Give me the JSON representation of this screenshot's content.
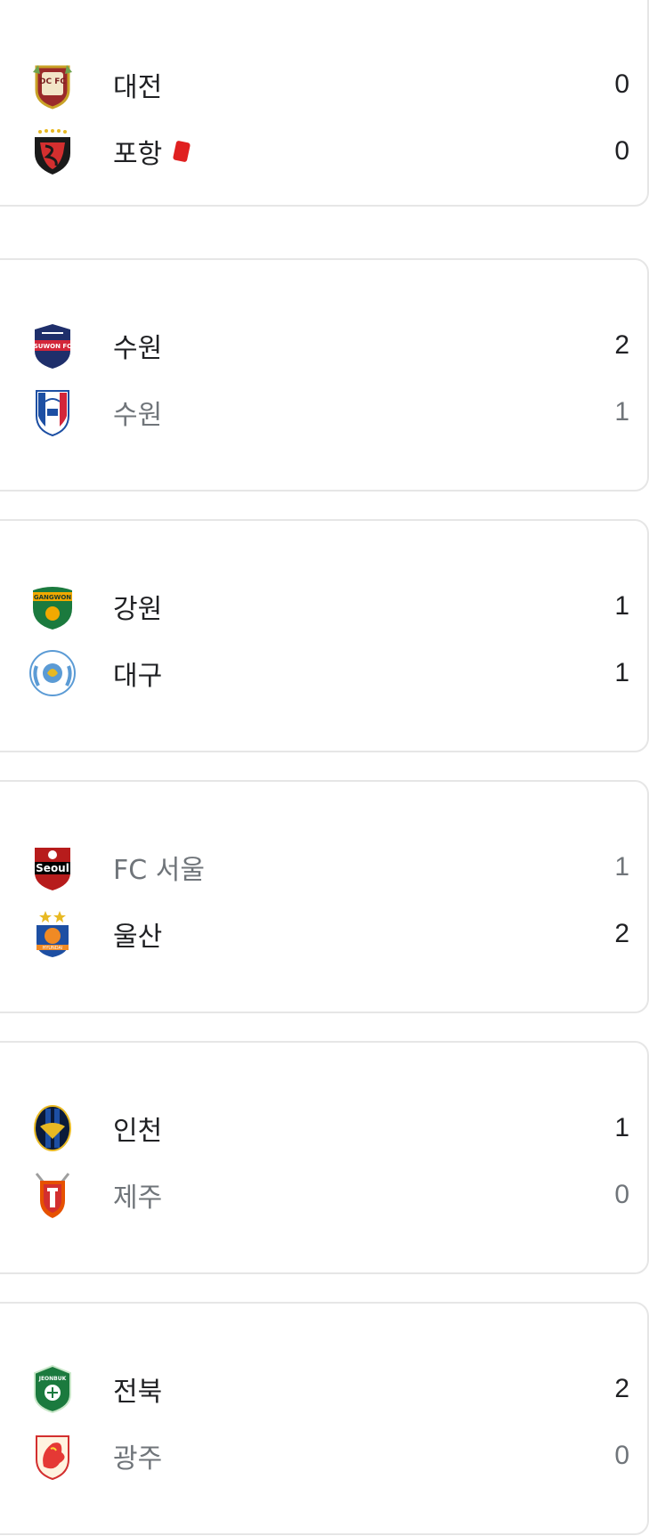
{
  "matches": [
    {
      "home": {
        "name": "대전",
        "score": "0",
        "crest": "daejeon-crest-icon"
      },
      "away": {
        "name": "포항",
        "score": "0",
        "crest": "pohang-crest-icon",
        "red_card": true
      }
    },
    {
      "home": {
        "name": "수원",
        "score": "2",
        "crest": "suwon-fc-crest-icon"
      },
      "away": {
        "name": "수원",
        "score": "1",
        "crest": "suwon-samsung-crest-icon"
      }
    },
    {
      "home": {
        "name": "강원",
        "score": "1",
        "crest": "gangwon-crest-icon"
      },
      "away": {
        "name": "대구",
        "score": "1",
        "crest": "daegu-crest-icon"
      }
    },
    {
      "home": {
        "name": "FC 서울",
        "score": "1",
        "crest": "fc-seoul-crest-icon"
      },
      "away": {
        "name": "울산",
        "score": "2",
        "crest": "ulsan-crest-icon"
      }
    },
    {
      "home": {
        "name": "인천",
        "score": "1",
        "crest": "incheon-crest-icon"
      },
      "away": {
        "name": "제주",
        "score": "0",
        "crest": "jeju-crest-icon"
      }
    },
    {
      "home": {
        "name": "전북",
        "score": "2",
        "crest": "jeonbuk-crest-icon"
      },
      "away": {
        "name": "광주",
        "score": "0",
        "crest": "gwangju-crest-icon"
      }
    }
  ],
  "crest_labels": {
    "daejeon": "DC FC",
    "suwon_fc": "SUWON FC",
    "gangwon": "GANGWON",
    "seoul": "Seoul",
    "ulsan": "HYUNDAI",
    "jeonbuk": "JEONBUK"
  },
  "colors": {
    "text_primary": "#202124",
    "text_secondary": "#70757a",
    "card_border": "#e6e6e6",
    "red_card": "#e02020"
  }
}
